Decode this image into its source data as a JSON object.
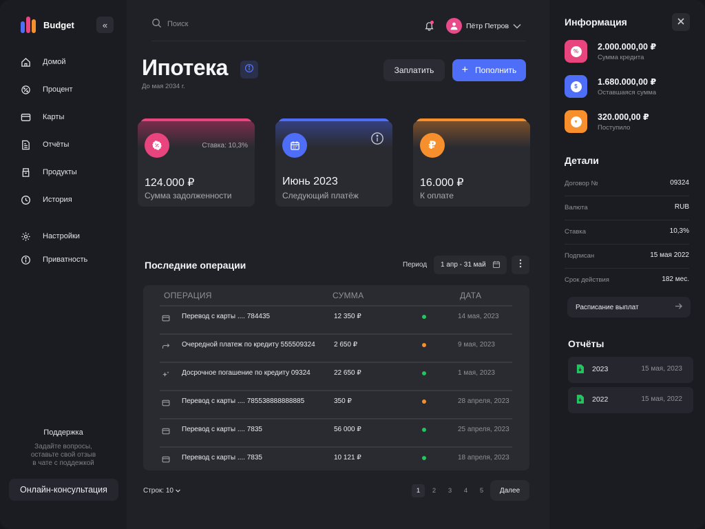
{
  "brand": {
    "name": "Budget"
  },
  "sidebar": {
    "nav": [
      {
        "label": "Домой",
        "icon": "home-icon"
      },
      {
        "label": "Процент",
        "icon": "percent-icon"
      },
      {
        "label": "Карты",
        "icon": "card-icon"
      },
      {
        "label": "Отчёты",
        "icon": "reports-icon"
      },
      {
        "label": "Продукты",
        "icon": "products-icon"
      },
      {
        "label": "История",
        "icon": "history-icon"
      }
    ],
    "nav2": [
      {
        "label": "Настройки",
        "icon": "gear-icon"
      },
      {
        "label": "Приватность",
        "icon": "shield-icon"
      }
    ],
    "support_title": "Поддержка",
    "support_text": [
      "Задайте вопросы,",
      "оставьте свой отзыв",
      "в чате с поддежкой"
    ],
    "consult_label": "Онлайн-консультация"
  },
  "header": {
    "search_placeholder": "Поиск",
    "user_name": "Пётр Петров"
  },
  "page": {
    "title": "Ипотека",
    "subtitle": "До мая 2034 г.",
    "pay_label": "Заплатить",
    "topup_label": "Пополнить"
  },
  "cards": [
    {
      "value": "124.000 ₽",
      "label": "Сумма задолженности",
      "rate": "Ставка: 10,3%",
      "color": "#e8457f",
      "icon": "percent-icon"
    },
    {
      "value": "Июнь 2023",
      "label": "Следующий платёж",
      "color": "#4f6ef7",
      "icon": "calendar-icon"
    },
    {
      "value": "16.000 ₽",
      "label": "К оплате",
      "color": "#f7902c",
      "icon": "ruble-icon"
    }
  ],
  "operations": {
    "title": "Последние операции",
    "period_label": "Период",
    "period_value": "1 апр - 31 май",
    "columns": [
      "ОПЕРАЦИЯ",
      "СУММА",
      "ДАТА"
    ],
    "rows": [
      {
        "op": "Перевод с карты .... 784435",
        "amount": "12 350 ₽",
        "status": "green",
        "date": "14 мая, 2023",
        "icon": "card-icon"
      },
      {
        "op": "Очередной платеж по кредиту 555509324",
        "amount": "2 650 ₽",
        "status": "orange",
        "date": "9 мая, 2023",
        "icon": "transfer-icon"
      },
      {
        "op": "Досрочное погашение по кредиту 09324",
        "amount": "22 650 ₽",
        "status": "green",
        "date": "1 мая, 2023",
        "icon": "sparkle-icon"
      },
      {
        "op": "Перевод с карты .... 785538888888885",
        "amount": "350 ₽",
        "status": "orange",
        "date": "28 апреля, 2023",
        "icon": "card-icon"
      },
      {
        "op": "Перевод с карты .... 7835",
        "amount": "56 000 ₽",
        "status": "green",
        "date": "25 апреля, 2023",
        "icon": "card-icon"
      },
      {
        "op": "Перевод с карты .... 7835",
        "amount": "10 121 ₽",
        "status": "green",
        "date": "18 апреля, 2023",
        "icon": "card-icon"
      }
    ],
    "rows_per_page": "Строк: 10",
    "pages": [
      "1",
      "2",
      "3",
      "4",
      "5"
    ],
    "active_page": "1",
    "next_label": "Далее"
  },
  "info_panel": {
    "title": "Информация",
    "stats": [
      {
        "value": "2.000.000,00 ₽",
        "label": "Сумма кредита",
        "color": "#e8457f",
        "glyph": "%"
      },
      {
        "value": "1.680.000,00 ₽",
        "label": "Оставшаяся сумма",
        "color": "#4f6ef7",
        "glyph": "$"
      },
      {
        "value": "320.000,00 ₽",
        "label": "Поступило",
        "color": "#f7902c",
        "glyph": "▾"
      }
    ],
    "details_title": "Детали",
    "details": [
      {
        "k": "Договор №",
        "v": "09324"
      },
      {
        "k": "Валюта",
        "v": "RUB"
      },
      {
        "k": "Ставка",
        "v": "10,3%"
      },
      {
        "k": "Подписан",
        "v": "15 мая 2022"
      },
      {
        "k": "Срок действия",
        "v": "182 мес."
      }
    ],
    "schedule_label": "Расписание выплат",
    "reports_title": "Отчёты",
    "reports": [
      {
        "year": "2023",
        "date": "15 мая, 2023"
      },
      {
        "year": "2022",
        "date": "15 мая, 2022"
      }
    ]
  },
  "colors": {
    "accent": "#4f6ef7",
    "pink": "#e8457f",
    "orange": "#f7902c",
    "green": "#22c55e"
  }
}
